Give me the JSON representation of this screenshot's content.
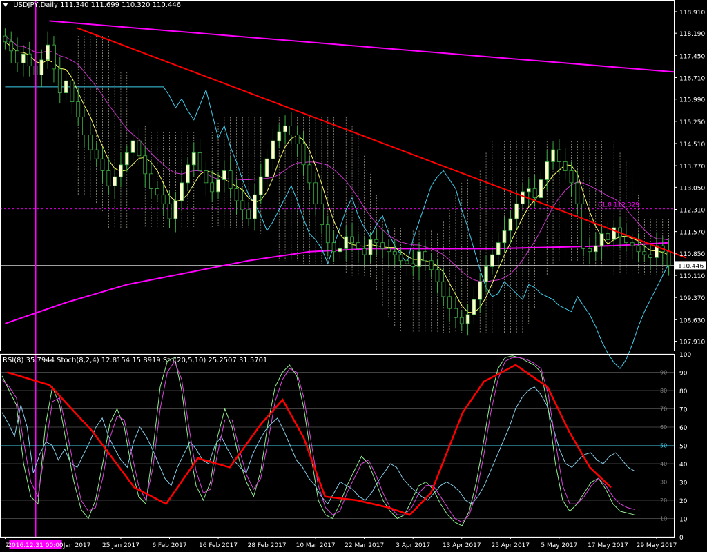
{
  "main_header": {
    "symbol": "USDJPY,Daily",
    "ohlc": "111.340 111.699 110.320 110.446"
  },
  "osc_header": {
    "rsi": "RSI(8) 35.7944",
    "stoch": "Stoch(8,2,4) 12.8154 15.8919",
    "sto": "Sto(20,5,10) 25.2507 31.5701"
  },
  "colors": {
    "background": "#000000",
    "axis": "#ffffff",
    "bull_candle": "#ffffcc",
    "bear_candle": "#000000",
    "wick": "#3cb043",
    "cloud": "#ffffe0",
    "trendline": "#ff0000",
    "long_trendline": "#ff00ff",
    "ma_long": "#ff00ff",
    "cyan_line": "#40d0f0",
    "yellow_line": "#ffff66",
    "magenta_line": "#cc33cc",
    "rsi_line": "#ff0000",
    "stoch_main": "#90ee90",
    "stoch_signal": "#dd44dd",
    "sto_line": "#87ceeb",
    "cursor": "#ff00ff",
    "current_price": "#ffffff"
  },
  "chart_data": [
    {
      "type": "candlestick",
      "panel": "price",
      "ylim": [
        107.6,
        119.3
      ],
      "y_ticks": [
        "118.910",
        "118.190",
        "117.450",
        "116.710",
        "115.990",
        "115.250",
        "114.510",
        "113.770",
        "113.050",
        "112.310",
        "111.570",
        "110.850",
        "110.110",
        "109.370",
        "108.630",
        "107.910"
      ],
      "y_tick_values": [
        118.91,
        118.19,
        117.45,
        116.71,
        115.99,
        115.25,
        114.51,
        113.77,
        113.05,
        112.31,
        111.57,
        110.85,
        110.11,
        109.37,
        108.63,
        107.91
      ],
      "x_labels": [
        "21",
        "13 Jan 2017",
        "25 Jan 2017",
        "6 Feb 2017",
        "16 Feb 2017",
        "28 Feb 2017",
        "10 Mar 2017",
        "22 Mar 2017",
        "3 Apr 2017",
        "13 Apr 2017",
        "25 Apr 2017",
        "5 May 2017",
        "17 May 2017",
        "29 May 2017"
      ],
      "x_label_index": [
        0,
        11,
        19,
        27,
        35,
        43,
        51,
        59,
        67,
        75,
        83,
        91,
        99,
        107
      ],
      "cursor_label": "2016.12.31 00:00",
      "cursor_index": 5,
      "current_price": 110.446,
      "current_price_label": "110.446",
      "fib_level": 112.329,
      "fib_label": "61.8 112.329",
      "closes": [
        117.9,
        117.6,
        117.2,
        117.5,
        117.1,
        116.8,
        117.3,
        117.8,
        117.0,
        116.2,
        116.6,
        115.9,
        115.4,
        114.8,
        114.3,
        114.0,
        113.6,
        113.1,
        113.4,
        113.8,
        114.2,
        114.6,
        114.1,
        113.5,
        113.0,
        112.8,
        112.5,
        112.0,
        112.6,
        113.2,
        113.8,
        114.2,
        113.6,
        113.2,
        112.9,
        113.3,
        113.6,
        113.0,
        112.6,
        112.3,
        112.0,
        112.8,
        113.4,
        114.0,
        114.6,
        114.9,
        115.1,
        114.8,
        114.5,
        113.8,
        113.2,
        112.5,
        111.8,
        111.2,
        110.9,
        111.0,
        111.4,
        111.2,
        111.0,
        110.8,
        111.3,
        111.2,
        111.0,
        110.9,
        110.8,
        110.6,
        110.5,
        110.4,
        110.9,
        110.6,
        110.3,
        109.9,
        109.4,
        109.0,
        108.7,
        108.5,
        108.8,
        109.3,
        109.9,
        110.4,
        110.8,
        111.2,
        111.6,
        112.0,
        112.5,
        112.9,
        113.0,
        112.7,
        113.3,
        113.9,
        114.3,
        113.9,
        113.6,
        113.2,
        112.5,
        111.0,
        110.9,
        111.1,
        111.5,
        111.3,
        111.7,
        111.4,
        111.2,
        111.1,
        110.9,
        110.8,
        110.7,
        111.1,
        110.9,
        110.446
      ],
      "overlays": {
        "ma_long": [
          [
            0,
            108.5
          ],
          [
            10,
            109.2
          ],
          [
            20,
            109.8
          ],
          [
            30,
            110.2
          ],
          [
            40,
            110.6
          ],
          [
            50,
            110.9
          ],
          [
            60,
            111.0
          ],
          [
            70,
            111.0
          ],
          [
            80,
            111.0
          ],
          [
            90,
            111.05
          ],
          [
            100,
            111.1
          ],
          [
            109,
            111.2
          ]
        ],
        "red_trendline": [
          [
            5,
            118.6
          ],
          [
            109,
            110.7
          ]
        ],
        "magenta_trendline": [
          [
            5,
            118.6
          ],
          [
            122,
            117.0
          ]
        ],
        "rsi_line": [
          [
            0,
            90
          ],
          [
            8,
            83
          ],
          [
            16,
            58
          ],
          [
            24,
            27
          ],
          [
            30,
            18
          ],
          [
            36,
            43
          ],
          [
            42,
            38
          ],
          [
            48,
            62
          ],
          [
            52,
            75
          ],
          [
            56,
            54
          ],
          [
            60,
            22
          ],
          [
            66,
            20
          ],
          [
            72,
            16
          ],
          [
            76,
            12
          ],
          [
            80,
            24
          ],
          [
            86,
            68
          ],
          [
            90,
            85
          ],
          [
            96,
            94
          ],
          [
            102,
            82
          ],
          [
            106,
            58
          ],
          [
            110,
            38
          ],
          [
            114,
            27
          ]
        ]
      }
    },
    {
      "type": "line",
      "panel": "oscillator",
      "ylim": [
        0,
        100
      ],
      "y_ticks": [
        "100",
        "90",
        "80",
        "70",
        "60",
        "50",
        "40",
        "30",
        "20",
        "10",
        "0"
      ],
      "y_tick_values": [
        100,
        90,
        80,
        70,
        60,
        50,
        40,
        30,
        20,
        10,
        0
      ],
      "highlight_level": 50,
      "series": [
        {
          "name": "RSI(8)",
          "color_key": "sto_line",
          "values": [
            68,
            62,
            55,
            72,
            60,
            35,
            45,
            52,
            50,
            42,
            48,
            40,
            38,
            45,
            52,
            60,
            65,
            55,
            48,
            42,
            38,
            52,
            60,
            55,
            48,
            40,
            32,
            28,
            38,
            45,
            52,
            48,
            42,
            40,
            50,
            55,
            48,
            42,
            38,
            35,
            45,
            52,
            58,
            62,
            65,
            58,
            50,
            42,
            38,
            32,
            28,
            22,
            18,
            24,
            30,
            28,
            26,
            22,
            20,
            24,
            30,
            35,
            40,
            38,
            32,
            28,
            25,
            22,
            20,
            24,
            28,
            30,
            28,
            25,
            20,
            18,
            22,
            28,
            36,
            44,
            52,
            60,
            70,
            76,
            80,
            82,
            78,
            72,
            60,
            48,
            40,
            38,
            42,
            45,
            46,
            42,
            40,
            44,
            46,
            42,
            38,
            36
          ]
        },
        {
          "name": "Stoch(8,2,4)",
          "color_key": "stoch_main",
          "values": [
            88,
            80,
            72,
            40,
            22,
            18,
            60,
            82,
            72,
            50,
            30,
            15,
            10,
            20,
            40,
            62,
            70,
            60,
            38,
            22,
            18,
            48,
            82,
            96,
            98,
            80,
            50,
            28,
            20,
            30,
            55,
            70,
            60,
            42,
            30,
            22,
            36,
            62,
            82,
            90,
            94,
            88,
            70,
            44,
            20,
            12,
            10,
            18,
            28,
            36,
            44,
            40,
            30,
            20,
            14,
            10,
            12,
            20,
            28,
            30,
            26,
            18,
            12,
            8,
            6,
            14,
            30,
            52,
            76,
            92,
            98,
            99,
            98,
            96,
            94,
            90,
            70,
            40,
            20,
            14,
            18,
            24,
            30,
            32,
            26,
            18,
            14,
            13,
            12
          ]
        },
        {
          "name": "Stoch signal",
          "color_key": "stoch_signal",
          "values": [
            86,
            82,
            76,
            52,
            30,
            22,
            48,
            74,
            76,
            58,
            38,
            20,
            14,
            16,
            32,
            54,
            66,
            64,
            46,
            28,
            20,
            38,
            70,
            90,
            96,
            86,
            60,
            36,
            24,
            26,
            46,
            64,
            64,
            48,
            34,
            26,
            32,
            52,
            74,
            86,
            92,
            90,
            76,
            52,
            28,
            16,
            12,
            14,
            24,
            32,
            40,
            42,
            34,
            24,
            16,
            12,
            12,
            16,
            24,
            28,
            28,
            22,
            16,
            10,
            8,
            12,
            24,
            44,
            68,
            86,
            96,
            98,
            98,
            97,
            95,
            92,
            78,
            52,
            28,
            18,
            18,
            22,
            28,
            32,
            28,
            22,
            18,
            16,
            15
          ]
        }
      ]
    }
  ]
}
